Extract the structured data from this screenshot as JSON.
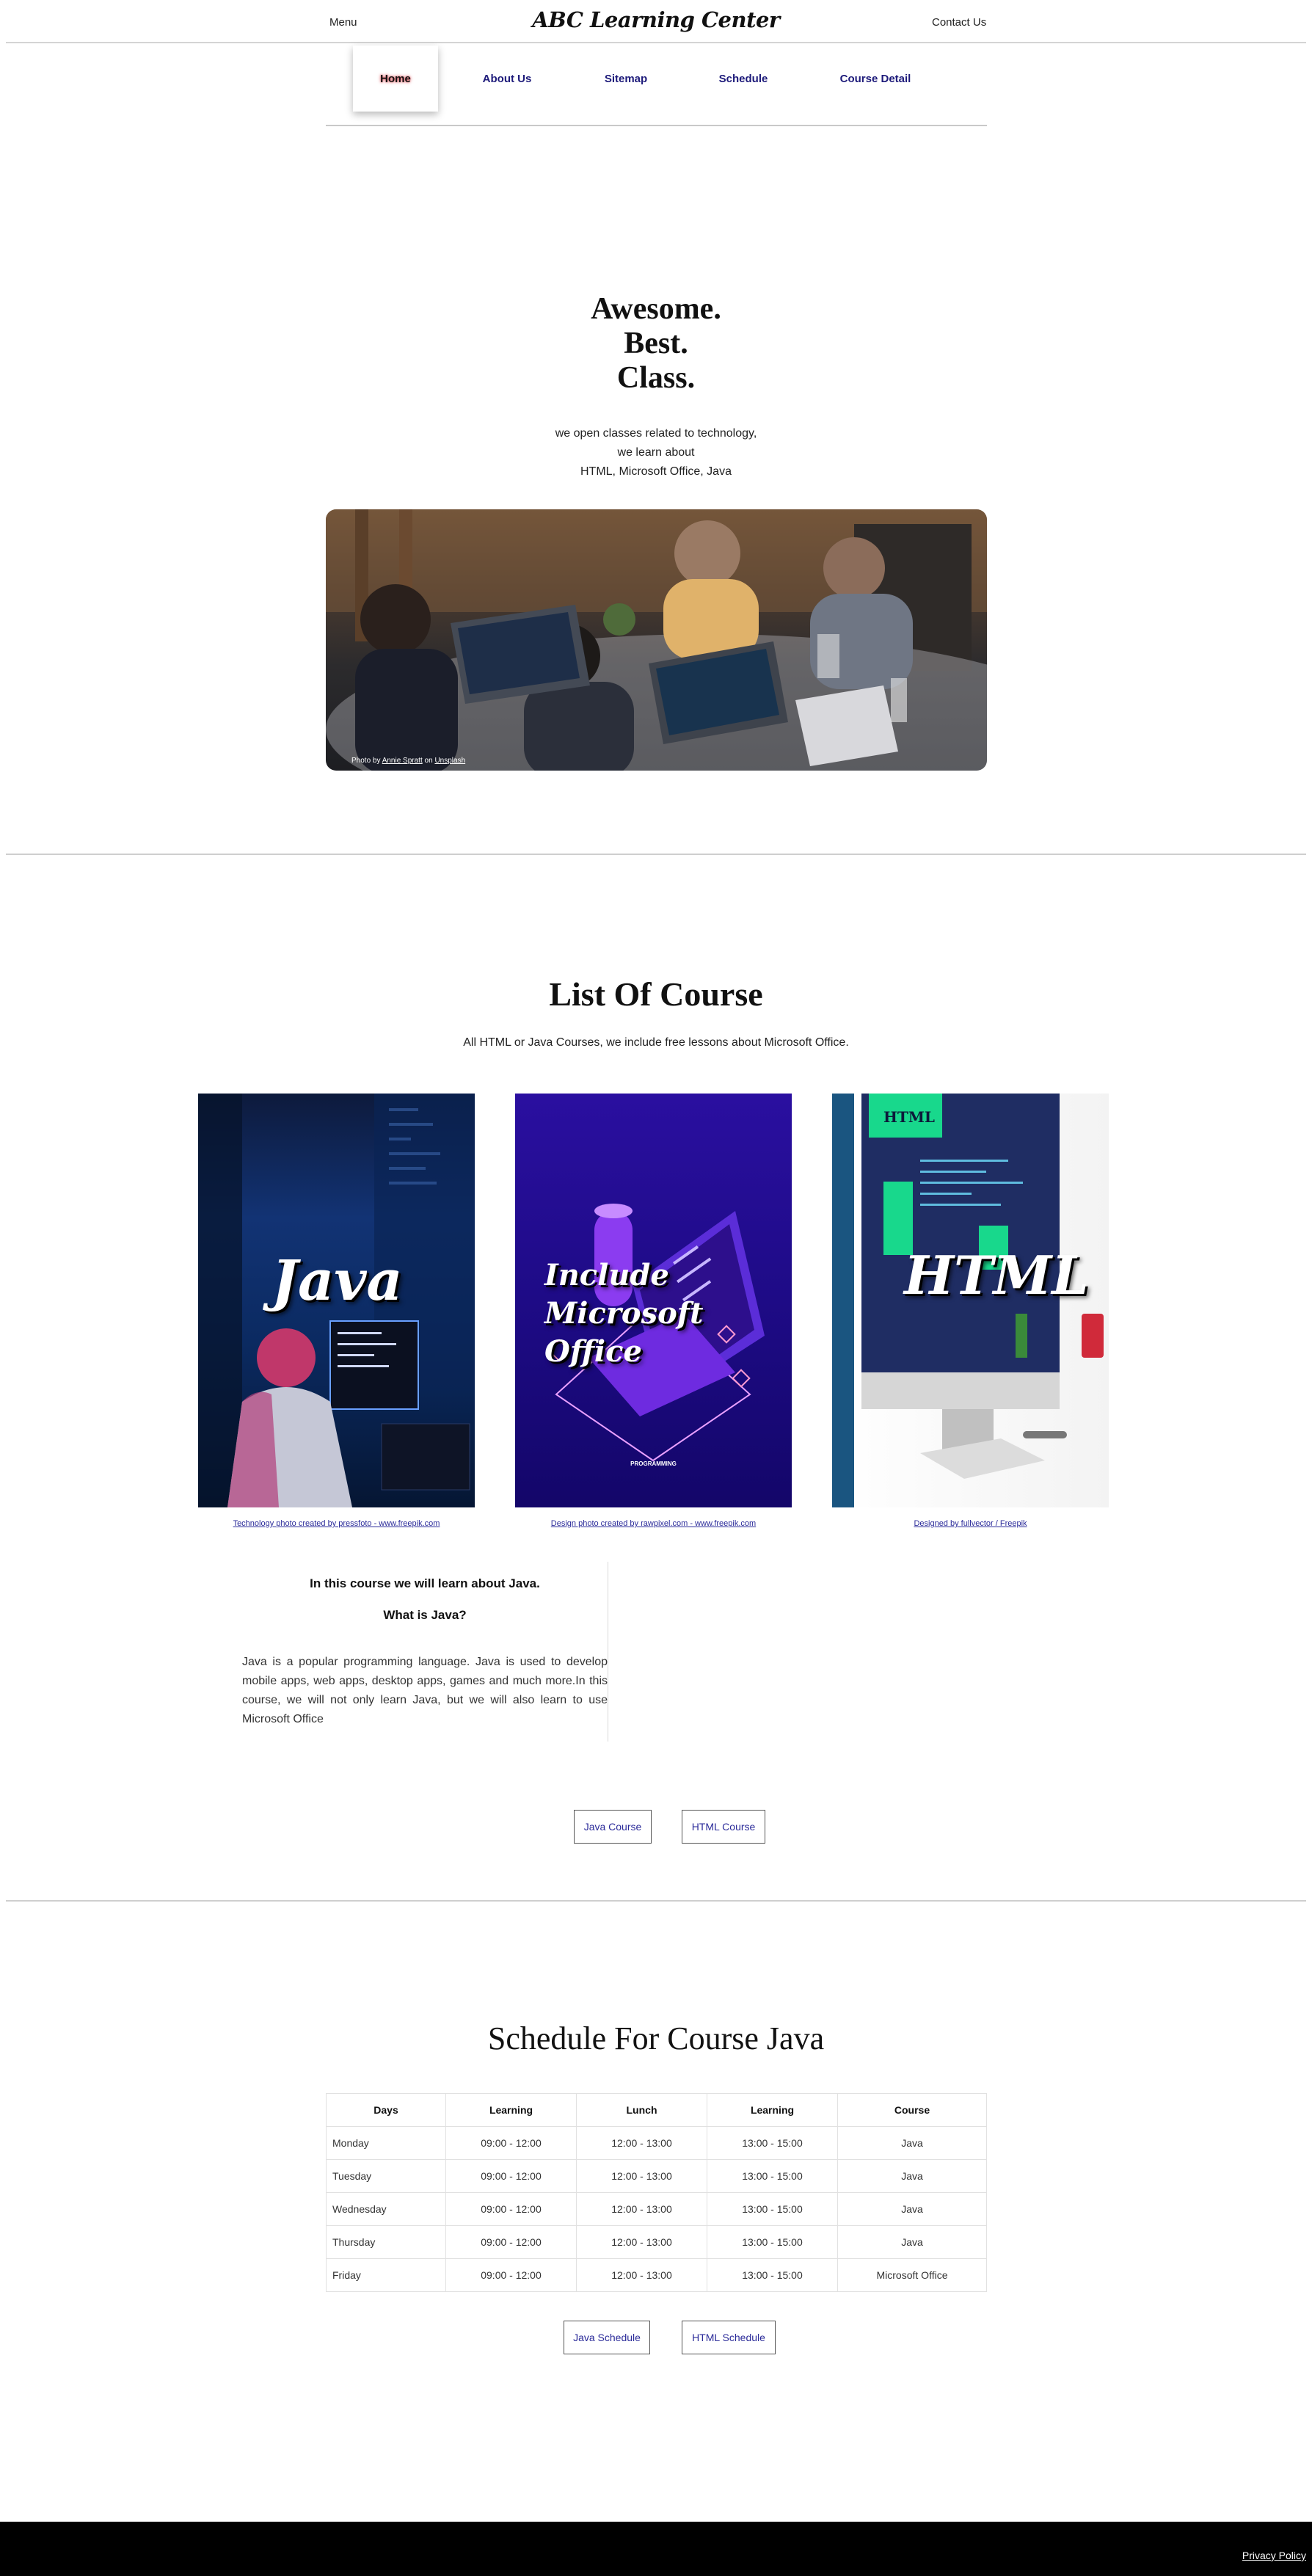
{
  "header": {
    "menu_label": "Menu",
    "brand": "ABC Learning Center",
    "contact_label": "Contact Us"
  },
  "nav": {
    "home": "Home",
    "about": "About Us",
    "sitemap": "Sitemap",
    "schedule": "Schedule",
    "course_detail": "Course Detail"
  },
  "hero": {
    "title_line1": "Awesome.",
    "title_line2": "Best.",
    "title_line3": "Class.",
    "sub_line1": "we open classes related to technology,",
    "sub_line2": "we learn about",
    "sub_line3": "HTML, Microsoft Office, Java",
    "credit_prefix": "Photo by ",
    "credit_author": "Annie Spratt",
    "credit_mid": " on ",
    "credit_site": "Unsplash"
  },
  "courses": {
    "title": "List Of Course",
    "subtitle": "All HTML or Java Courses, we include free lessons about Microsoft Office.",
    "cards": [
      {
        "label": "Java",
        "credit": "Technology photo created by pressfoto - www.freepik.com"
      },
      {
        "label_line1": "Include",
        "label_line2": "Microsoft Office",
        "credit": "Design photo created by rawpixel.com - www.freepik.com",
        "caption": "PROGRAMMING"
      },
      {
        "label": "HTML",
        "credit": "Designed by fullvector / Freepik",
        "screen_text": "HTML"
      }
    ],
    "about_heading": "In this course we will learn about Java.",
    "about_question": "What is Java?",
    "about_text": "Java is a popular programming language. Java is used to develop mobile apps, web apps, desktop apps, games and much more.In this course, we will not only learn Java, but we will also learn to use Microsoft Office",
    "btn_java": "Java Course",
    "btn_html": "HTML Course"
  },
  "schedule": {
    "title": "Schedule For Course Java",
    "headers": [
      "Days",
      "Learning",
      "Lunch",
      "Learning",
      "Course"
    ],
    "rows": [
      [
        "Monday",
        "09:00 - 12:00",
        "12:00 - 13:00",
        "13:00 - 15:00",
        "Java"
      ],
      [
        "Tuesday",
        "09:00 - 12:00",
        "12:00 - 13:00",
        "13:00 - 15:00",
        "Java"
      ],
      [
        "Wednesday",
        "09:00 - 12:00",
        "12:00 - 13:00",
        "13:00 - 15:00",
        "Java"
      ],
      [
        "Thursday",
        "09:00 - 12:00",
        "12:00 - 13:00",
        "13:00 - 15:00",
        "Java"
      ],
      [
        "Friday",
        "09:00 - 12:00",
        "12:00 - 13:00",
        "13:00 - 15:00",
        "Microsoft Office"
      ]
    ],
    "btn_java": "Java Schedule",
    "btn_html": "HTML Schedule"
  },
  "footer": {
    "privacy": "Privacy Policy"
  }
}
